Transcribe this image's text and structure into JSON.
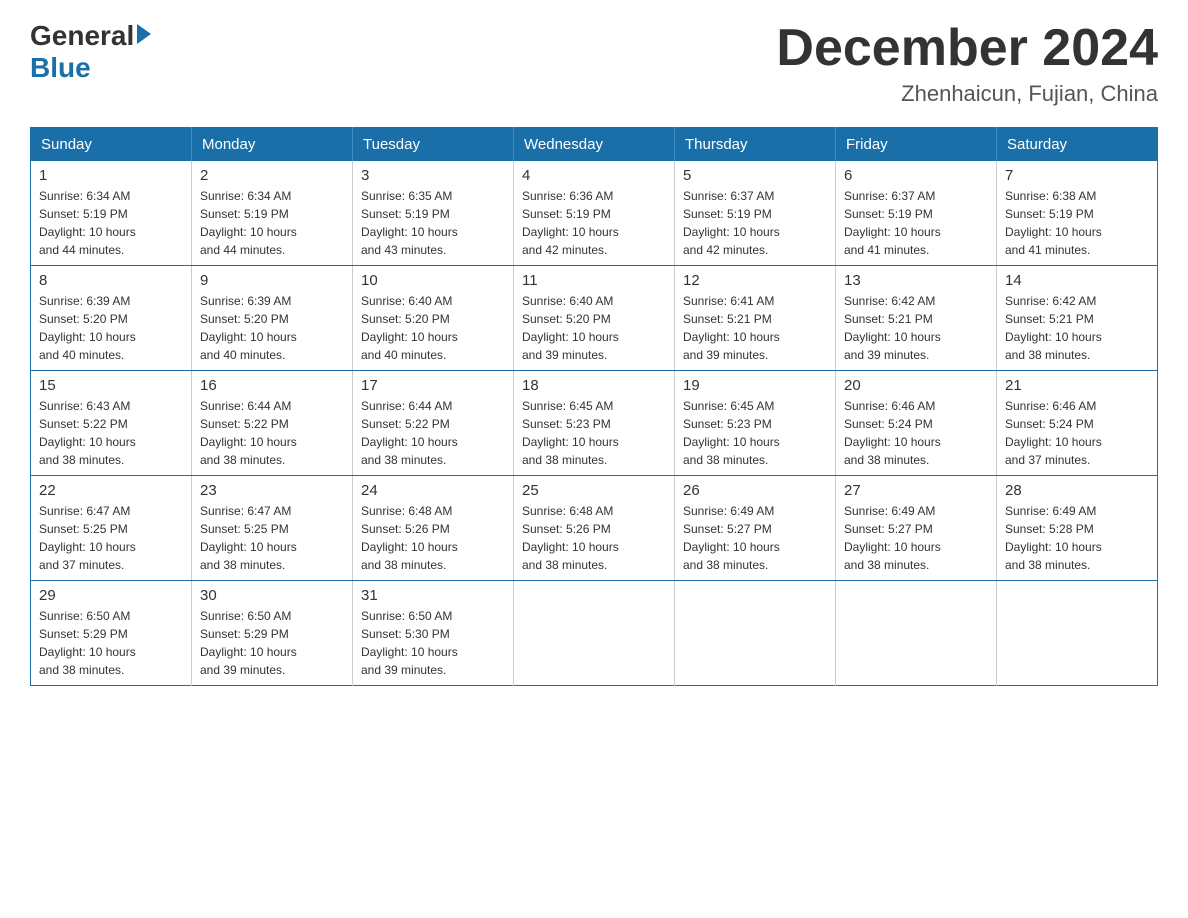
{
  "header": {
    "logo_general": "General",
    "logo_blue": "Blue",
    "month_title": "December 2024",
    "location": "Zhenhaicun, Fujian, China"
  },
  "weekdays": [
    "Sunday",
    "Monday",
    "Tuesday",
    "Wednesday",
    "Thursday",
    "Friday",
    "Saturday"
  ],
  "weeks": [
    [
      {
        "day": "1",
        "sunrise": "6:34 AM",
        "sunset": "5:19 PM",
        "daylight": "10 hours and 44 minutes."
      },
      {
        "day": "2",
        "sunrise": "6:34 AM",
        "sunset": "5:19 PM",
        "daylight": "10 hours and 44 minutes."
      },
      {
        "day": "3",
        "sunrise": "6:35 AM",
        "sunset": "5:19 PM",
        "daylight": "10 hours and 43 minutes."
      },
      {
        "day": "4",
        "sunrise": "6:36 AM",
        "sunset": "5:19 PM",
        "daylight": "10 hours and 42 minutes."
      },
      {
        "day": "5",
        "sunrise": "6:37 AM",
        "sunset": "5:19 PM",
        "daylight": "10 hours and 42 minutes."
      },
      {
        "day": "6",
        "sunrise": "6:37 AM",
        "sunset": "5:19 PM",
        "daylight": "10 hours and 41 minutes."
      },
      {
        "day": "7",
        "sunrise": "6:38 AM",
        "sunset": "5:19 PM",
        "daylight": "10 hours and 41 minutes."
      }
    ],
    [
      {
        "day": "8",
        "sunrise": "6:39 AM",
        "sunset": "5:20 PM",
        "daylight": "10 hours and 40 minutes."
      },
      {
        "day": "9",
        "sunrise": "6:39 AM",
        "sunset": "5:20 PM",
        "daylight": "10 hours and 40 minutes."
      },
      {
        "day": "10",
        "sunrise": "6:40 AM",
        "sunset": "5:20 PM",
        "daylight": "10 hours and 40 minutes."
      },
      {
        "day": "11",
        "sunrise": "6:40 AM",
        "sunset": "5:20 PM",
        "daylight": "10 hours and 39 minutes."
      },
      {
        "day": "12",
        "sunrise": "6:41 AM",
        "sunset": "5:21 PM",
        "daylight": "10 hours and 39 minutes."
      },
      {
        "day": "13",
        "sunrise": "6:42 AM",
        "sunset": "5:21 PM",
        "daylight": "10 hours and 39 minutes."
      },
      {
        "day": "14",
        "sunrise": "6:42 AM",
        "sunset": "5:21 PM",
        "daylight": "10 hours and 38 minutes."
      }
    ],
    [
      {
        "day": "15",
        "sunrise": "6:43 AM",
        "sunset": "5:22 PM",
        "daylight": "10 hours and 38 minutes."
      },
      {
        "day": "16",
        "sunrise": "6:44 AM",
        "sunset": "5:22 PM",
        "daylight": "10 hours and 38 minutes."
      },
      {
        "day": "17",
        "sunrise": "6:44 AM",
        "sunset": "5:22 PM",
        "daylight": "10 hours and 38 minutes."
      },
      {
        "day": "18",
        "sunrise": "6:45 AM",
        "sunset": "5:23 PM",
        "daylight": "10 hours and 38 minutes."
      },
      {
        "day": "19",
        "sunrise": "6:45 AM",
        "sunset": "5:23 PM",
        "daylight": "10 hours and 38 minutes."
      },
      {
        "day": "20",
        "sunrise": "6:46 AM",
        "sunset": "5:24 PM",
        "daylight": "10 hours and 38 minutes."
      },
      {
        "day": "21",
        "sunrise": "6:46 AM",
        "sunset": "5:24 PM",
        "daylight": "10 hours and 37 minutes."
      }
    ],
    [
      {
        "day": "22",
        "sunrise": "6:47 AM",
        "sunset": "5:25 PM",
        "daylight": "10 hours and 37 minutes."
      },
      {
        "day": "23",
        "sunrise": "6:47 AM",
        "sunset": "5:25 PM",
        "daylight": "10 hours and 38 minutes."
      },
      {
        "day": "24",
        "sunrise": "6:48 AM",
        "sunset": "5:26 PM",
        "daylight": "10 hours and 38 minutes."
      },
      {
        "day": "25",
        "sunrise": "6:48 AM",
        "sunset": "5:26 PM",
        "daylight": "10 hours and 38 minutes."
      },
      {
        "day": "26",
        "sunrise": "6:49 AM",
        "sunset": "5:27 PM",
        "daylight": "10 hours and 38 minutes."
      },
      {
        "day": "27",
        "sunrise": "6:49 AM",
        "sunset": "5:27 PM",
        "daylight": "10 hours and 38 minutes."
      },
      {
        "day": "28",
        "sunrise": "6:49 AM",
        "sunset": "5:28 PM",
        "daylight": "10 hours and 38 minutes."
      }
    ],
    [
      {
        "day": "29",
        "sunrise": "6:50 AM",
        "sunset": "5:29 PM",
        "daylight": "10 hours and 38 minutes."
      },
      {
        "day": "30",
        "sunrise": "6:50 AM",
        "sunset": "5:29 PM",
        "daylight": "10 hours and 39 minutes."
      },
      {
        "day": "31",
        "sunrise": "6:50 AM",
        "sunset": "5:30 PM",
        "daylight": "10 hours and 39 minutes."
      },
      null,
      null,
      null,
      null
    ]
  ],
  "labels": {
    "sunrise": "Sunrise:",
    "sunset": "Sunset:",
    "daylight": "Daylight:"
  }
}
